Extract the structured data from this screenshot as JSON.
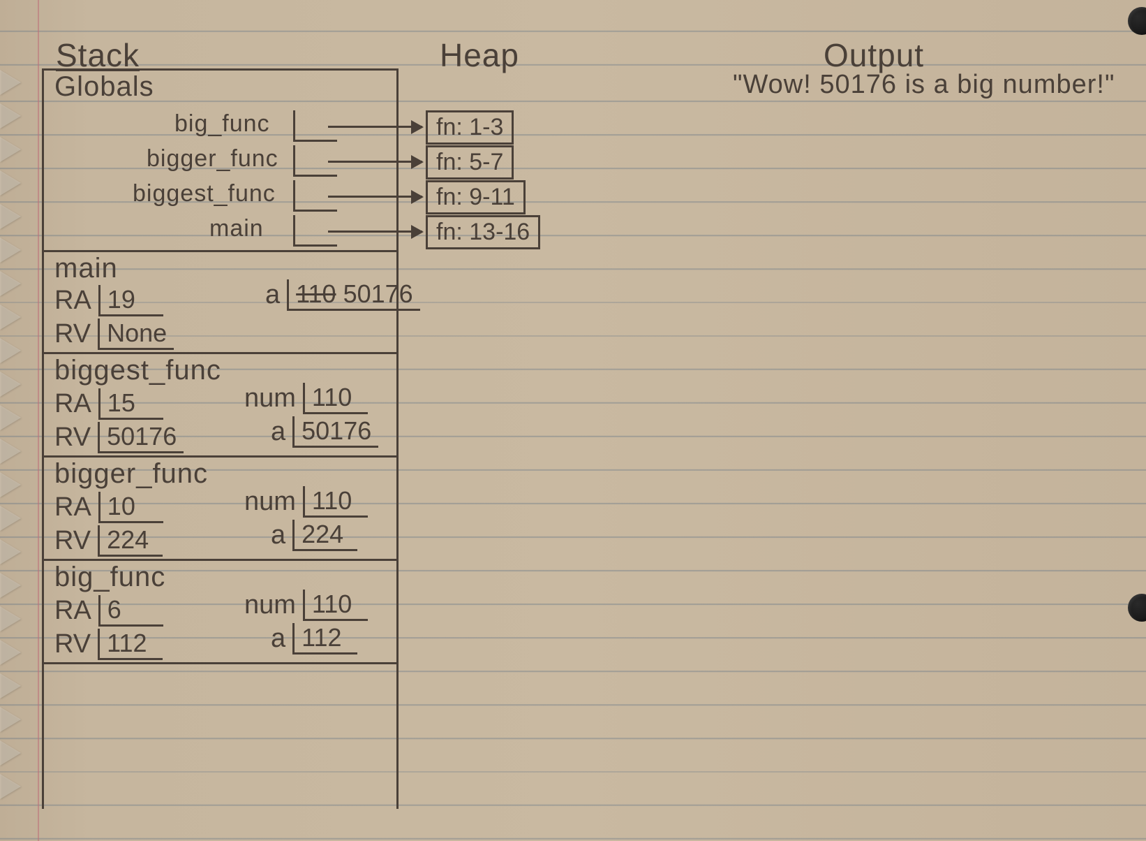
{
  "headers": {
    "stack": "Stack",
    "heap": "Heap",
    "output": "Output"
  },
  "output_text": "\"Wow! 50176 is a big number!\"",
  "globals": {
    "title": "Globals",
    "entries": [
      {
        "name": "big_func",
        "heap": "fn: 1-3"
      },
      {
        "name": "bigger_func",
        "heap": "fn: 5-7"
      },
      {
        "name": "biggest_func",
        "heap": "fn: 9-11"
      },
      {
        "name": "main",
        "heap": "fn: 13-16"
      }
    ]
  },
  "frames": [
    {
      "name": "main",
      "ra": "19",
      "rv": "None",
      "vars": [
        {
          "name": "a",
          "old": "110",
          "val": "50176"
        }
      ]
    },
    {
      "name": "biggest_func",
      "ra": "15",
      "rv": "50176",
      "vars": [
        {
          "name": "num",
          "val": "110"
        },
        {
          "name": "a",
          "val": "50176"
        }
      ]
    },
    {
      "name": "bigger_func",
      "ra": "10",
      "rv": "224",
      "vars": [
        {
          "name": "num",
          "val": "110"
        },
        {
          "name": "a",
          "val": "224"
        }
      ]
    },
    {
      "name": "big_func",
      "ra": "6",
      "rv": "112",
      "vars": [
        {
          "name": "num",
          "val": "110"
        },
        {
          "name": "a",
          "val": "112"
        }
      ]
    }
  ]
}
